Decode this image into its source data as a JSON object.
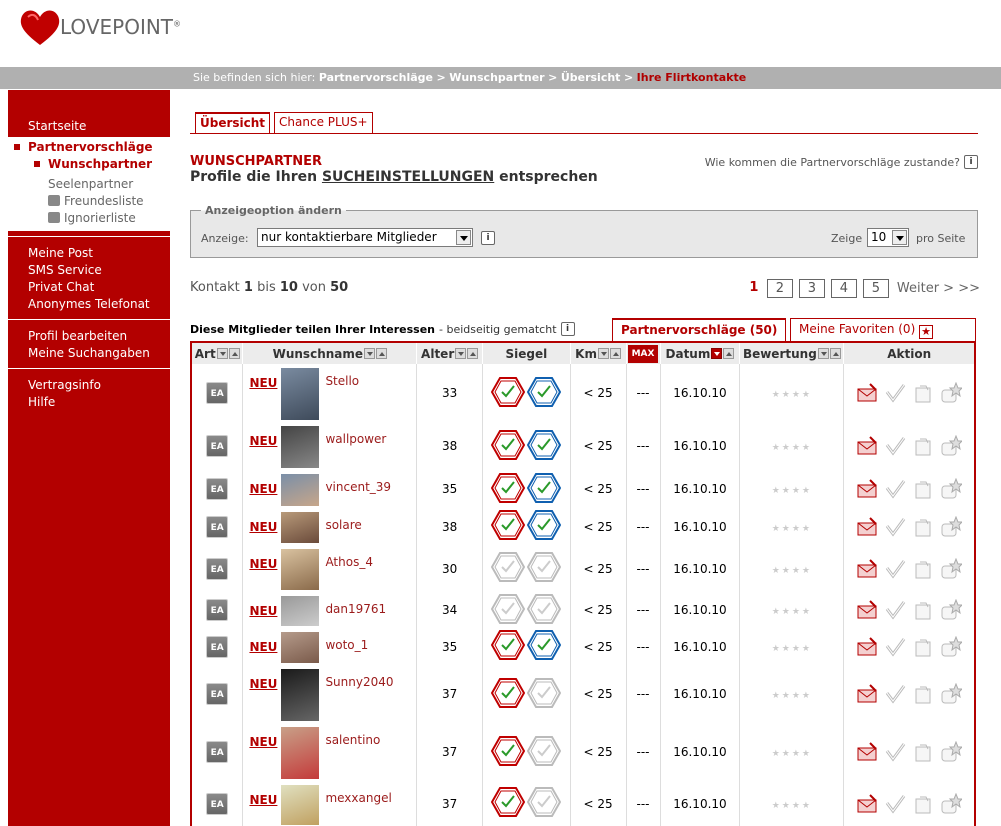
{
  "logo": {
    "text": "LOVEPOINT",
    "reg": "®"
  },
  "breadcrumb": {
    "prefix": "Sie befinden sich hier:",
    "items": [
      "Partnervorschläge",
      "Wunschpartner",
      "Übersicht"
    ],
    "sep": ">",
    "current": "Ihre Flirtkontakte"
  },
  "sidebar": {
    "start": "Startseite",
    "partner": "Partnervorschläge",
    "wunsch": "Wunschpartner",
    "seelen": "Seelenpartner",
    "freunde": "Freundesliste",
    "ignor": "Ignorierliste",
    "post": "Meine Post",
    "sms": "SMS Service",
    "chat": "Privat Chat",
    "tel": "Anonymes Telefonat",
    "profil": "Profil bearbeiten",
    "such": "Meine Suchangaben",
    "vertrag": "Vertragsinfo",
    "hilfe": "Hilfe"
  },
  "tabs": {
    "overview": "Übersicht",
    "plus": "Chance PLUS+"
  },
  "heading": {
    "title": "WUNSCHPARTNER",
    "sub_prefix": "Profile die Ihren",
    "sub_link": "SUCHEINSTELLUNGEN",
    "sub_suffix": "entsprechen",
    "how": "Wie kommen die Partnervorschläge zustande?"
  },
  "options": {
    "legend": "Anzeigeoption ändern",
    "label": "Anzeige:",
    "select": "nur kontaktierbare Mitglieder",
    "zeige": "Zeige",
    "count": "10",
    "prosite": "pro Seite"
  },
  "counter": {
    "prefix": "Kontakt",
    "from": "1",
    "bis": "bis",
    "to": "10",
    "von": "von",
    "total": "50"
  },
  "pager": {
    "current": "1",
    "pages": [
      "2",
      "3",
      "4",
      "5"
    ],
    "next": "Weiter > >>"
  },
  "interests": {
    "bold": "Diese Mitglieder teilen Ihrer Interessen",
    "norm": "- beidseitig gematcht"
  },
  "list_tabs": {
    "a": "Partnervorschläge (50)",
    "b": "Meine Favoriten (0)"
  },
  "columns": [
    "Art",
    "Wunschname",
    "Alter",
    "Siegel",
    "Km",
    "Datum",
    "Bewertung",
    "Aktion"
  ],
  "km_icon": "MAX",
  "rows": [
    {
      "art": "EA",
      "neu": "NEU",
      "name": "Stello",
      "age": "33",
      "seal1": true,
      "seal2": true,
      "km": "< 25",
      "col": "---",
      "date": "16.10.10",
      "h": 58
    },
    {
      "art": "EA",
      "neu": "NEU",
      "name": "wallpower",
      "age": "38",
      "seal1": true,
      "seal2": true,
      "km": "< 25",
      "col": "---",
      "date": "16.10.10",
      "h": 48
    },
    {
      "art": "EA",
      "neu": "NEU",
      "name": "vincent_39",
      "age": "35",
      "seal1": true,
      "seal2": true,
      "km": "< 25",
      "col": "---",
      "date": "16.10.10",
      "h": 38
    },
    {
      "art": "EA",
      "neu": "NEU",
      "name": "solare",
      "age": "38",
      "seal1": true,
      "seal2": true,
      "km": "< 25",
      "col": "---",
      "date": "16.10.10",
      "h": 37
    },
    {
      "art": "EA",
      "neu": "NEU",
      "name": "Athos_4",
      "age": "30",
      "seal1": false,
      "seal2": false,
      "km": "< 25",
      "col": "---",
      "date": "16.10.10",
      "h": 47
    },
    {
      "art": "EA",
      "neu": "NEU",
      "name": "dan19761",
      "age": "34",
      "seal1": false,
      "seal2": false,
      "km": "< 25",
      "col": "---",
      "date": "16.10.10",
      "h": 36
    },
    {
      "art": "EA",
      "neu": "NEU",
      "name": "woto_1",
      "age": "35",
      "seal1": true,
      "seal2": true,
      "km": "< 25",
      "col": "---",
      "date": "16.10.10",
      "h": 37
    },
    {
      "art": "EA",
      "neu": "NEU",
      "name": "Sunny2040",
      "age": "37",
      "seal1": true,
      "seal2": false,
      "km": "< 25",
      "col": "---",
      "date": "16.10.10",
      "h": 58
    },
    {
      "art": "EA",
      "neu": "NEU",
      "name": "salentino",
      "age": "37",
      "seal1": true,
      "seal2": false,
      "km": "< 25",
      "col": "---",
      "date": "16.10.10",
      "h": 58
    },
    {
      "art": "EA",
      "neu": "NEU",
      "name": "mexxangel",
      "age": "37",
      "seal1": true,
      "seal2": false,
      "km": "< 25",
      "col": "---",
      "date": "16.10.10",
      "h": 46
    }
  ],
  "colors": {
    "brand": "#b30000",
    "grey": "#b0b0b0"
  }
}
